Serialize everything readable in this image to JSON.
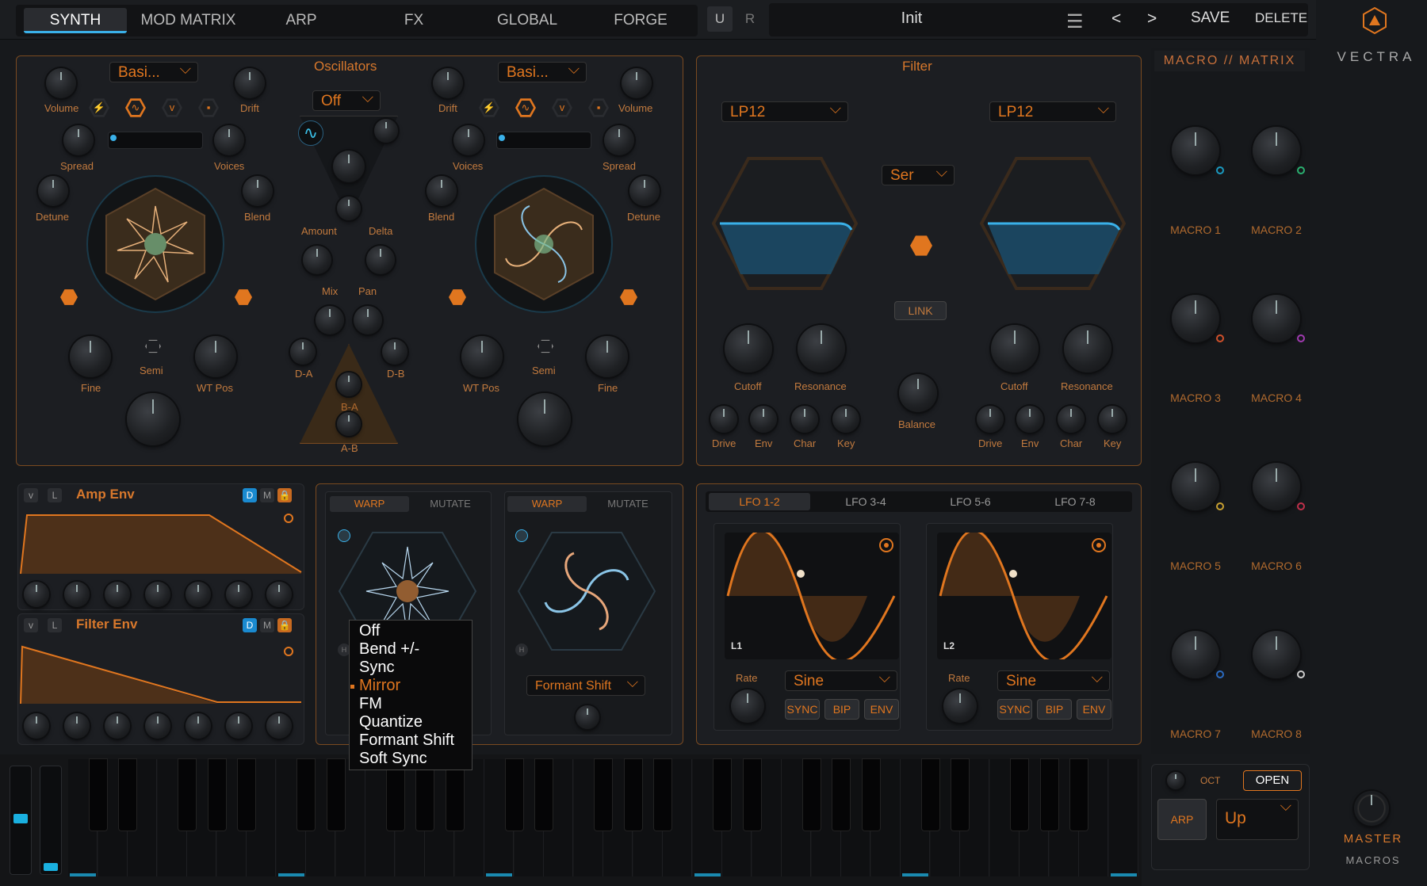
{
  "topbar": {
    "tabs": [
      "SYNTH",
      "MOD MATRIX",
      "ARP",
      "FX",
      "GLOBAL",
      "FORGE"
    ],
    "active_tab": "SYNTH",
    "u_label": "U",
    "r_label": "R",
    "preset_name": "Init",
    "prev": "<",
    "next": ">",
    "save": "SAVE",
    "delete": "DELETE"
  },
  "brand": {
    "name": "VECTRA"
  },
  "oscillators": {
    "title": "Oscillators",
    "osc_a_wave": "Basi...",
    "osc_b_wave": "Basi...",
    "sub_mode": "Off",
    "labels": {
      "volume": "Volume",
      "drift": "Drift",
      "spread": "Spread",
      "voices": "Voices",
      "detune": "Detune",
      "blend": "Blend",
      "fine": "Fine",
      "semi": "Semi",
      "wt_pos": "WT Pos",
      "amount": "Amount",
      "delta": "Delta",
      "mix": "Mix",
      "pan": "Pan",
      "d_a": "D-A",
      "d_b": "D-B",
      "b_a": "B-A",
      "a_b": "A-B"
    }
  },
  "filter": {
    "title": "Filter",
    "type_1": "LP12",
    "type_2": "LP12",
    "routing": "Ser",
    "link": "LINK",
    "labels": {
      "cutoff": "Cutoff",
      "resonance": "Resonance",
      "drive": "Drive",
      "env": "Env",
      "char": "Char",
      "key": "Key",
      "balance": "Balance"
    }
  },
  "macros": {
    "title": "MACRO // MATRIX",
    "items": [
      "MACRO 1",
      "MACRO 2",
      "MACRO 3",
      "MACRO 4",
      "MACRO 5",
      "MACRO 6",
      "MACRO 7",
      "MACRO 8"
    ],
    "ring_colors": [
      "#1a9ac0",
      "#2ab070",
      "#d0502a",
      "#a03ab0",
      "#c8a030",
      "#c0304a",
      "#2a6ac0",
      "#cccccc"
    ]
  },
  "envelopes": {
    "amp": {
      "title": "Amp Env",
      "v": "v",
      "l": "L",
      "d": "D",
      "m": "M"
    },
    "filter": {
      "title": "Filter Env",
      "v": "v",
      "l": "L",
      "d": "D",
      "m": "M"
    }
  },
  "warp": {
    "warp_label": "WARP",
    "mutate_label": "MUTATE",
    "mode_b": "Formant Shift",
    "h_label": "H"
  },
  "warp_menu": {
    "items": [
      "Off",
      "Bend +/-",
      "Sync",
      "Mirror",
      "FM",
      "Quantize",
      "Formant Shift",
      "Soft Sync"
    ],
    "selected": "Mirror"
  },
  "lfo": {
    "tabs": [
      "LFO 1-2",
      "LFO 3-4",
      "LFO 5-6",
      "LFO 7-8"
    ],
    "active_tab": "LFO 1-2",
    "l1": {
      "name": "L1",
      "shape": "Sine",
      "rate": "Rate",
      "sync": "SYNC",
      "bip": "BIP",
      "env": "ENV"
    },
    "l2": {
      "name": "L2",
      "shape": "Sine",
      "rate": "Rate",
      "sync": "SYNC",
      "bip": "BIP",
      "env": "ENV"
    }
  },
  "arp": {
    "oct": "OCT",
    "open": "OPEN",
    "arp": "ARP",
    "direction": "Up"
  },
  "master": {
    "label": "MASTER",
    "sub": "MACROS"
  },
  "colors": {
    "accent": "#e0761f",
    "blue": "#3ab0e8",
    "bg": "#17191c"
  }
}
